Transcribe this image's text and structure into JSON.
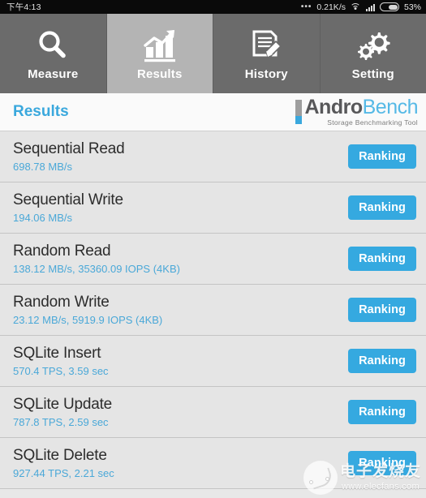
{
  "statusbar": {
    "clock": "下午4:13",
    "dots": "•••",
    "network_speed": "0.21K/s",
    "wifi_icon": "wifi-icon",
    "signal_icon": "cellular-signal-icon",
    "battery_icon": "battery-icon",
    "battery_percent": "53%"
  },
  "tabs": [
    {
      "label": "Measure",
      "icon": "magnifier-icon",
      "active": false
    },
    {
      "label": "Results",
      "icon": "bar-chart-icon",
      "active": true
    },
    {
      "label": "History",
      "icon": "document-pencil-icon",
      "active": false
    },
    {
      "label": "Setting",
      "icon": "gears-icon",
      "active": false
    }
  ],
  "header": {
    "title": "Results",
    "logo_andro": "Andro",
    "logo_bench": "Bench",
    "logo_tagline": "Storage Benchmarking Tool"
  },
  "button_label": "Ranking",
  "results": [
    {
      "name": "Sequential Read",
      "value": "698.78 MB/s"
    },
    {
      "name": "Sequential Write",
      "value": "194.06 MB/s"
    },
    {
      "name": "Random Read",
      "value": "138.12 MB/s, 35360.09 IOPS (4KB)"
    },
    {
      "name": "Random Write",
      "value": "23.12 MB/s, 5919.9 IOPS (4KB)"
    },
    {
      "name": "SQLite Insert",
      "value": "570.4 TPS, 3.59 sec"
    },
    {
      "name": "SQLite Update",
      "value": "787.8 TPS, 2.59 sec"
    },
    {
      "name": "SQLite Delete",
      "value": "927.44 TPS, 2.21 sec"
    }
  ],
  "watermark": {
    "cn_text": "电子发烧友",
    "url": "www.elecfans.com"
  },
  "colors": {
    "accent_blue": "#35a9e0",
    "value_blue": "#4aa8d8",
    "tab_inactive": "#6b6b6b",
    "tab_active": "#b4b4b4",
    "list_bg": "#e5e5e5"
  }
}
